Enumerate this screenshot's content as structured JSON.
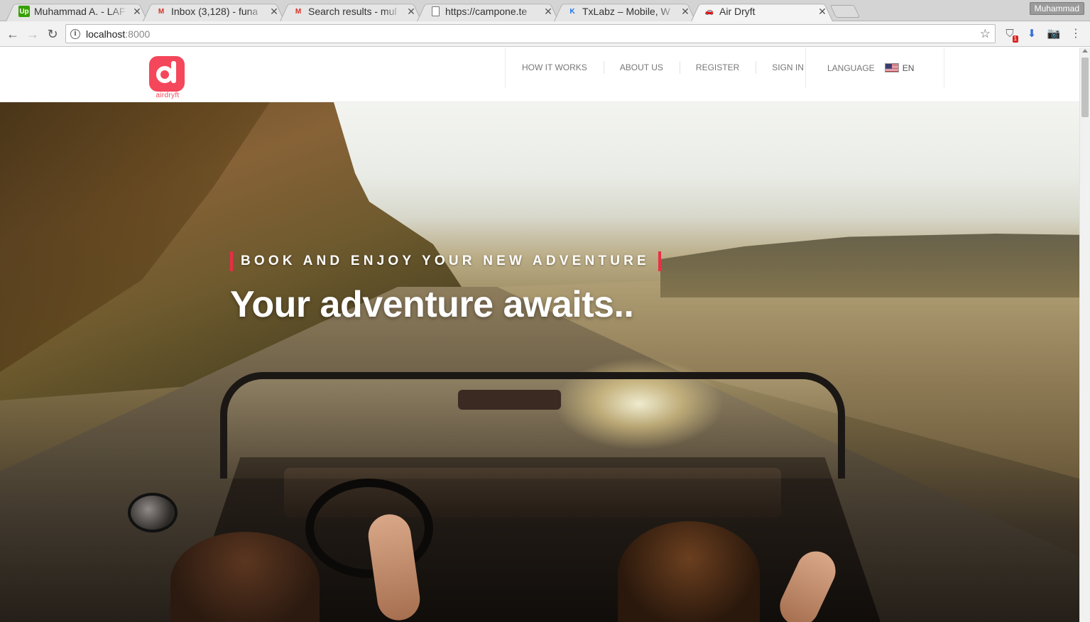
{
  "browser": {
    "tabs": [
      {
        "favicon": "upwork-icon",
        "title": "Muhammad A. - LAF",
        "active": false
      },
      {
        "favicon": "gmail-icon",
        "title": "Inbox (3,128) - funa",
        "active": false
      },
      {
        "favicon": "gmail-icon",
        "title": "Search results - mul",
        "active": false
      },
      {
        "favicon": "document-icon",
        "title": "https://campone.te",
        "active": false
      },
      {
        "favicon": "txlabz-icon",
        "title": "TxLabz – Mobile, W",
        "active": false
      },
      {
        "favicon": "car-icon",
        "title": "Air Dryft",
        "active": true
      }
    ],
    "profile_name": "Muhammad",
    "address": {
      "host": "localhost",
      "port": ":8000"
    },
    "extension_badge": "1"
  },
  "site": {
    "logo_text": "airdryft",
    "nav": [
      {
        "label": "HOW IT WORKS"
      },
      {
        "label": "ABOUT US"
      },
      {
        "label": "REGISTER"
      },
      {
        "label": "SIGN IN"
      }
    ],
    "language": {
      "label": "LANGUAGE",
      "code": "EN",
      "flag": "us-flag"
    }
  },
  "hero": {
    "eyebrow": "BOOK AND ENJOY YOUR NEW ADVENTURE",
    "headline": "Your adventure awaits..",
    "accent_color": "#ea2e45"
  },
  "colors": {
    "brand": "#f4475b",
    "accent": "#ea2e45"
  }
}
